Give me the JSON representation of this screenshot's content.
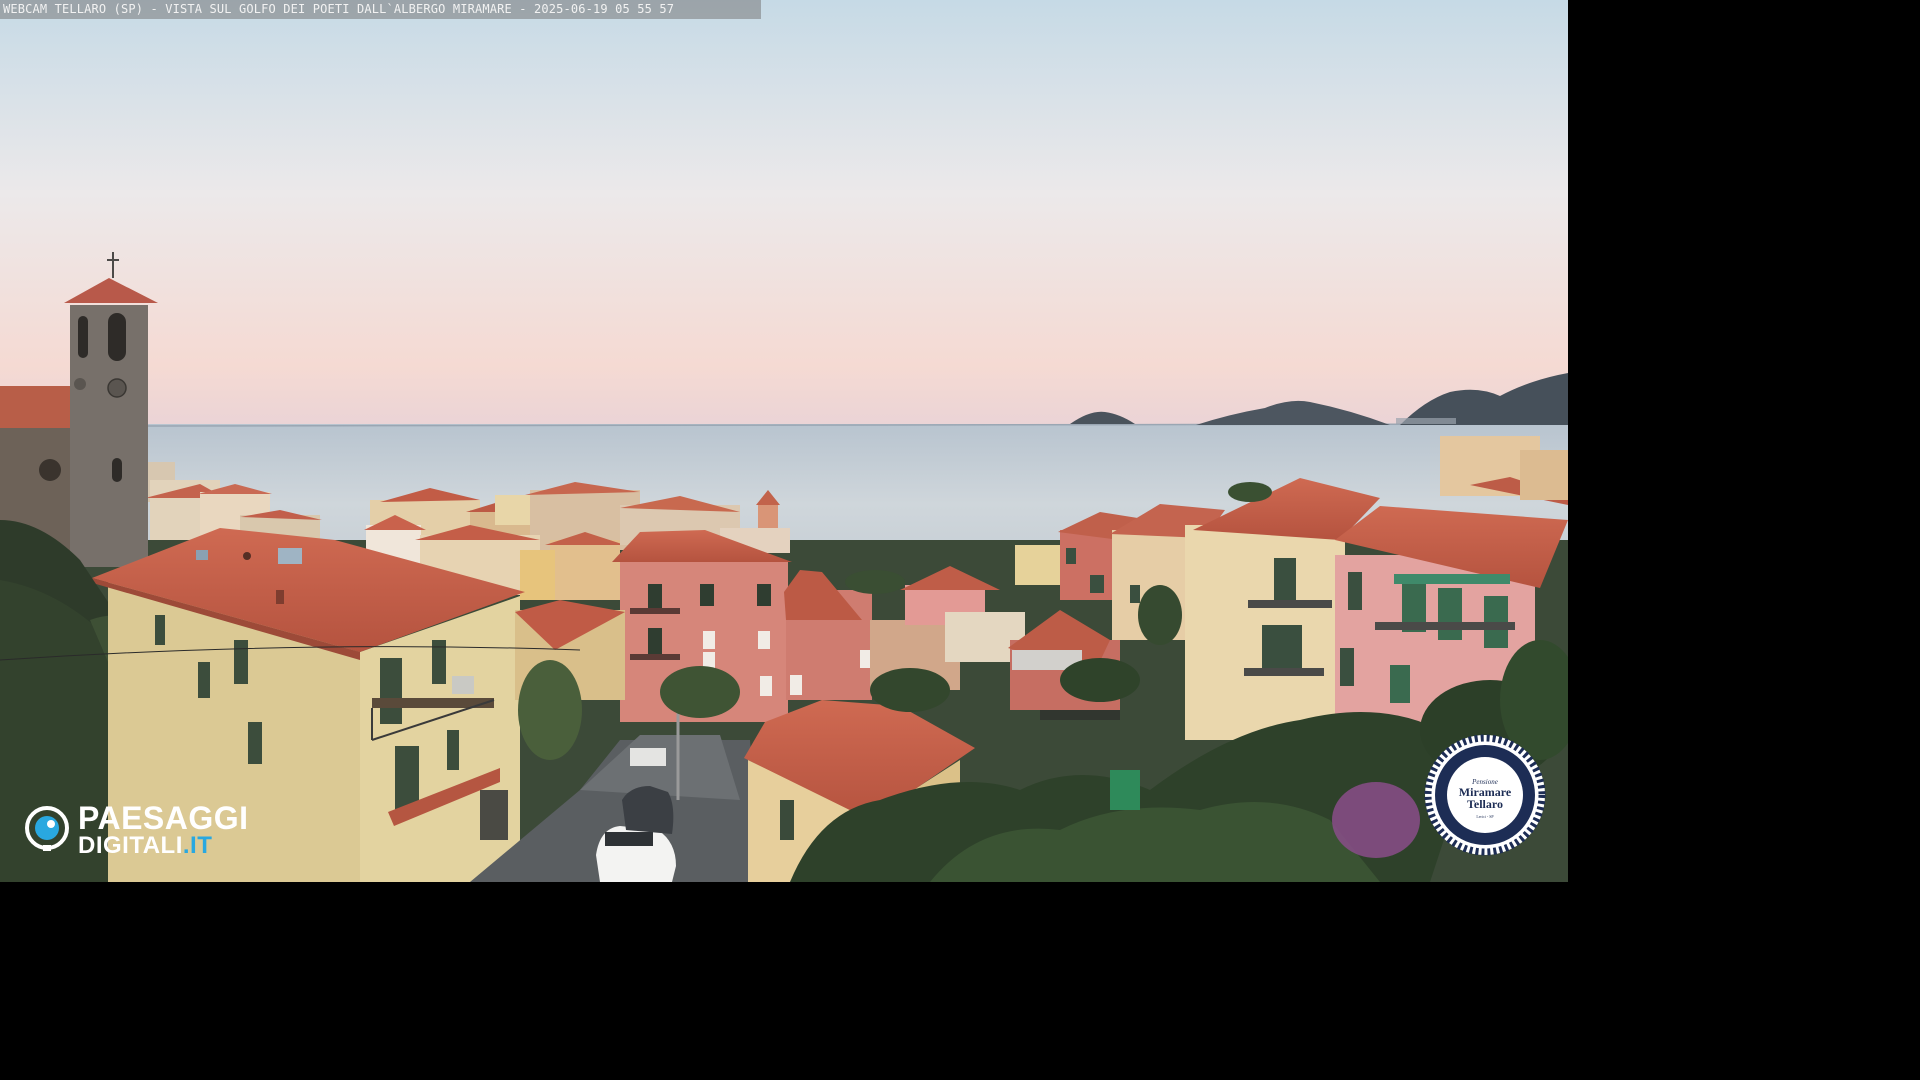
{
  "overlay": {
    "caption": "WEBCAM TELLARO (SP) - VISTA SUL GOLFO DEI POETI DALL`ALBERGO MIRAMARE - 2025-06-19 05 55 57"
  },
  "logo_left": {
    "line1": "PAESAGGI",
    "line2_main": "DIGITALI",
    "line2_tld": ".IT"
  },
  "logo_right": {
    "small": "Pensione",
    "line1": "Miramare",
    "line2": "Tellaro",
    "sub": "Lerici - SP"
  },
  "colors": {
    "sky_top": "#cfe0ea",
    "sky_horizon": "#f6d8d0",
    "sea": "#c4cfd6",
    "roof_terracotta": "#c8604a",
    "facade_pink": "#d9857a",
    "facade_yellow": "#e6cf9e",
    "accent_blue": "#29a8e0",
    "badge_navy": "#1d2d55"
  }
}
